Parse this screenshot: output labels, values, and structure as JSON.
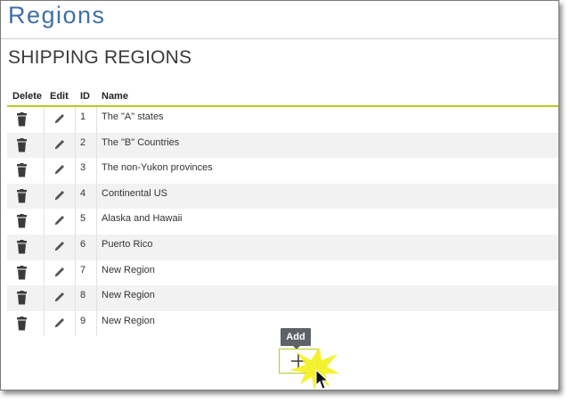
{
  "page": {
    "title": "Regions"
  },
  "section": {
    "title": "SHIPPING REGIONS"
  },
  "table": {
    "headers": {
      "delete": "Delete",
      "edit": "Edit",
      "id": "ID",
      "name": "Name"
    },
    "rows": [
      {
        "id": "1",
        "name": "The \"A\" states"
      },
      {
        "id": "2",
        "name": "The \"B\" Countries"
      },
      {
        "id": "3",
        "name": "The non-Yukon provinces"
      },
      {
        "id": "4",
        "name": "Continental US"
      },
      {
        "id": "5",
        "name": "Alaska and Hawaii"
      },
      {
        "id": "6",
        "name": "Puerto Rico"
      },
      {
        "id": "7",
        "name": "New Region"
      },
      {
        "id": "8",
        "name": "New Region"
      },
      {
        "id": "9",
        "name": "New Region"
      }
    ],
    "row_icons": {
      "delete": "trash-icon",
      "edit": "pencil-icon"
    }
  },
  "add": {
    "tooltip": "Add",
    "icon": "plus-icon"
  },
  "colors": {
    "title": "#3f6fa6",
    "accent": "#b9cc1b",
    "tooltip_bg": "#5f6368"
  }
}
